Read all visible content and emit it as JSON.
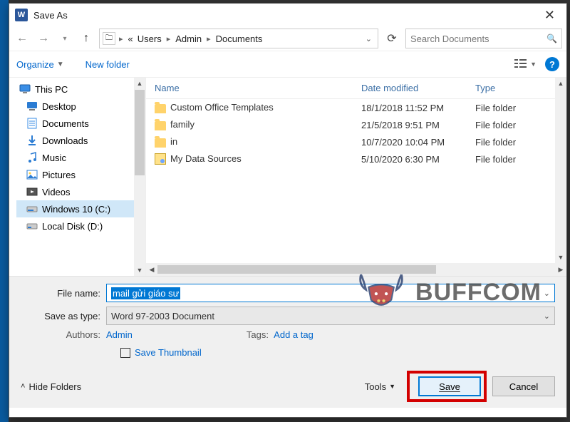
{
  "titlebar": {
    "title": "Save As"
  },
  "nav": {
    "breadcrumbs": {
      "prefix": "«",
      "p1": "Users",
      "p2": "Admin",
      "p3": "Documents"
    },
    "search_placeholder": "Search Documents"
  },
  "toolbar": {
    "organize": "Organize",
    "newfolder": "New folder"
  },
  "sidebar": {
    "thispc": "This PC",
    "items": [
      {
        "label": "Desktop"
      },
      {
        "label": "Documents"
      },
      {
        "label": "Downloads"
      },
      {
        "label": "Music"
      },
      {
        "label": "Pictures"
      },
      {
        "label": "Videos"
      },
      {
        "label": "Windows 10 (C:)"
      },
      {
        "label": "Local Disk (D:)"
      }
    ]
  },
  "files": {
    "columns": {
      "name": "Name",
      "date": "Date modified",
      "type": "Type"
    },
    "rows": [
      {
        "name": "Custom Office Templates",
        "date": "18/1/2018 11:52 PM",
        "type": "File folder",
        "icon": "folder"
      },
      {
        "name": "family",
        "date": "21/5/2018 9:51 PM",
        "type": "File folder",
        "icon": "folder"
      },
      {
        "name": "in",
        "date": "10/7/2020 10:04 PM",
        "type": "File folder",
        "icon": "folder"
      },
      {
        "name": "My Data Sources",
        "date": "5/10/2020 6:30 PM",
        "type": "File folder",
        "icon": "mds"
      }
    ]
  },
  "form": {
    "filename_label": "File name:",
    "filename_value": "mail gửi giáo sư",
    "savetype_label": "Save as type:",
    "savetype_value": "Word 97-2003 Document",
    "authors_label": "Authors:",
    "authors_value": "Admin",
    "tags_label": "Tags:",
    "tags_value": "Add a tag",
    "thumb_label": "Save Thumbnail",
    "hidefolders": "Hide Folders",
    "tools": "Tools",
    "save": "Save",
    "cancel": "Cancel"
  },
  "watermark": "BUFFCOM"
}
